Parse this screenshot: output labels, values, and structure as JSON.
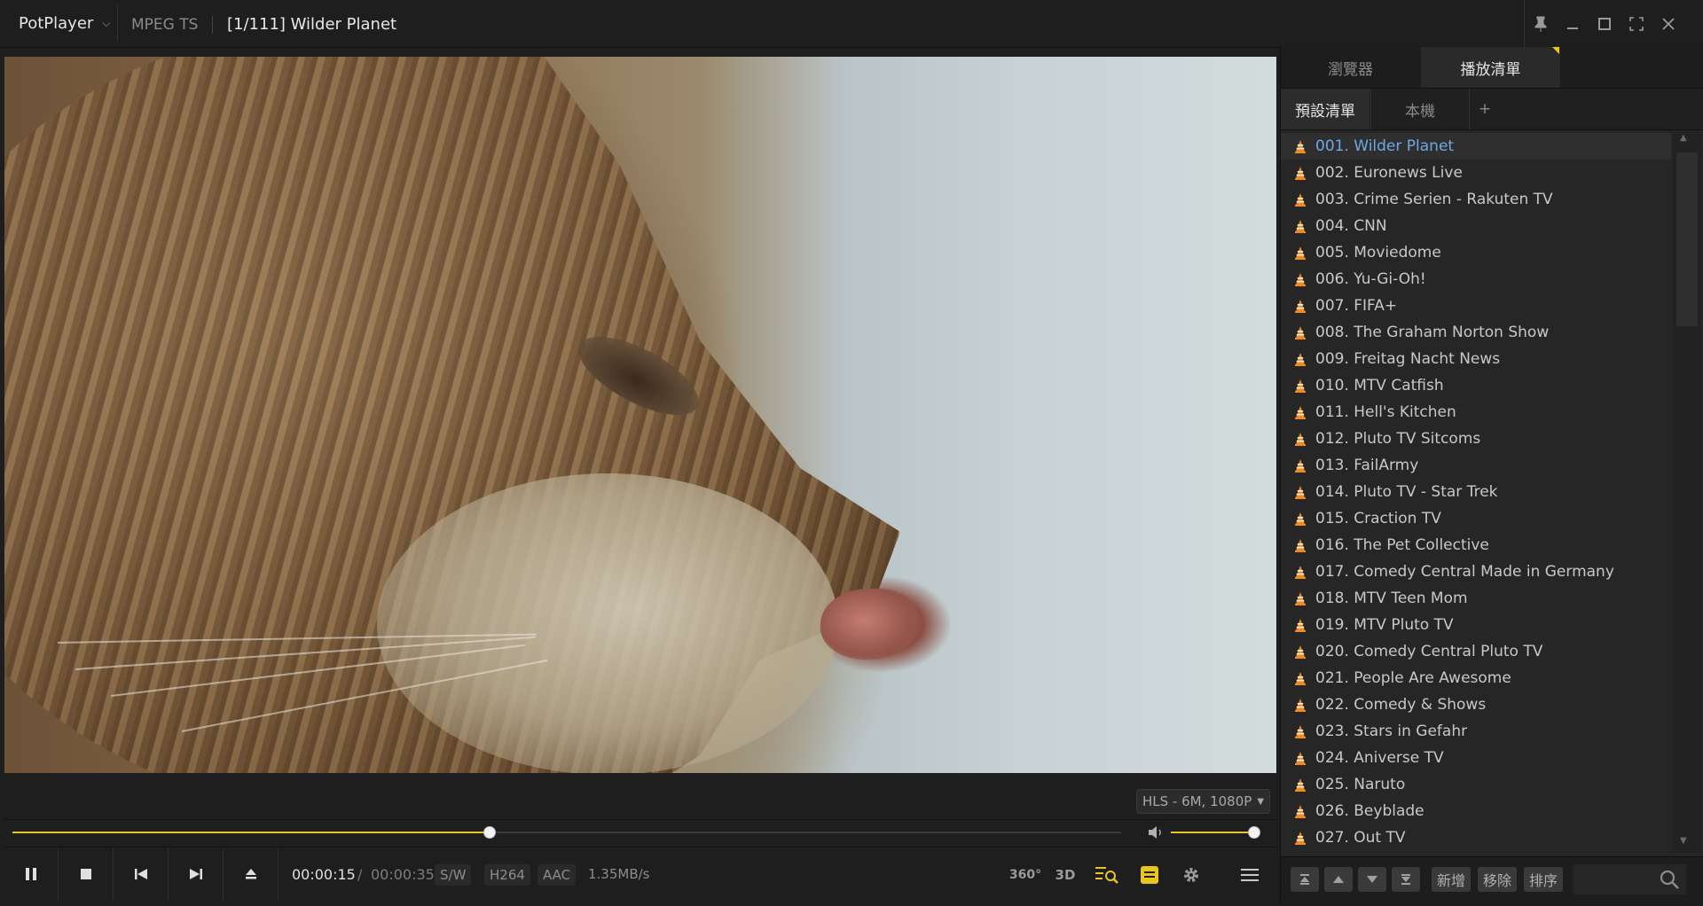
{
  "titlebar": {
    "brand": "PotPlayer",
    "format": "MPEG TS",
    "media_title": "[1/111] Wilder Planet"
  },
  "stream_quality": "HLS - 6M, 1080P",
  "playback": {
    "current_time": "00:00:15",
    "separator": "/",
    "total_time": "00:00:35",
    "progress_fraction": 0.43,
    "volume_fraction": 0.94
  },
  "tags": {
    "decoder": "S/W",
    "video_codec": "H264",
    "audio_codec": "AAC",
    "bitrate": "1.35MB/s"
  },
  "right_buttons": {
    "vr": "360°",
    "three_d": "3D"
  },
  "panel": {
    "tabs": [
      "瀏覽器",
      "播放清單"
    ],
    "active_tab": 1,
    "subtabs": [
      "預設清單",
      "本機",
      "+"
    ],
    "active_subtab": 0
  },
  "playlist": [
    "001. Wilder Planet",
    "002. Euronews Live",
    "003. Crime Serien - Rakuten TV",
    "004. CNN",
    "005. Moviedome",
    "006. Yu-Gi-Oh!",
    "007. FIFA+",
    "008. The Graham Norton Show",
    "009. Freitag Nacht News",
    "010. MTV Catfish",
    "011. Hell's Kitchen",
    "012. Pluto TV Sitcoms",
    "013. FailArmy",
    "014. Pluto TV - Star Trek",
    "015. Craction TV",
    "016. The Pet Collective",
    "017. Comedy Central Made in Germany",
    "018. MTV Teen Mom",
    "019. MTV Pluto TV",
    "020. Comedy Central Pluto TV",
    "021. People Are Awesome",
    "022. Comedy & Shows",
    "023. Stars in Gefahr",
    "024. Aniverse TV",
    "025. Naruto",
    "026. Beyblade",
    "027. Out TV"
  ],
  "active_index": 0,
  "list_buttons": {
    "add": "新增",
    "remove": "移除",
    "sort": "排序"
  },
  "colors": {
    "accent": "#e8c61c",
    "active_item": "#6fa8e6",
    "vlc_cone": "#f08a1c"
  }
}
